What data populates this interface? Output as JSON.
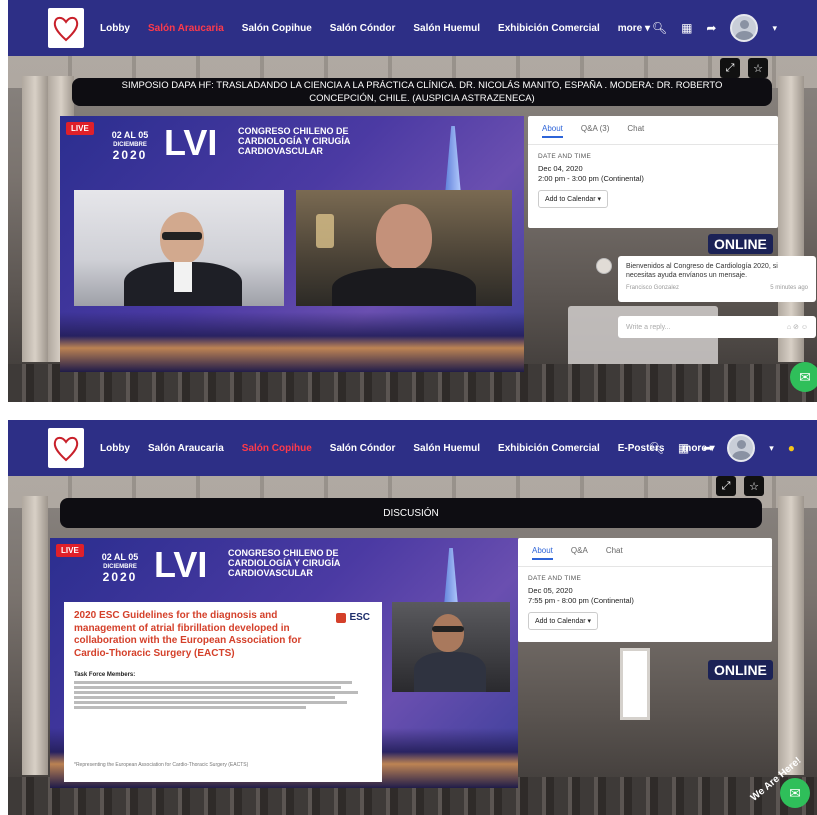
{
  "top": {
    "nav": {
      "items": [
        "Lobby",
        "Salón Araucaria",
        "Salón Copihue",
        "Salón Cóndor",
        "Salón Huemul",
        "Exhibición Comercial",
        "more"
      ],
      "active_index": 1
    },
    "session_title": "SIMPOSIO DAPA HF: TRASLADANDO LA CIENCIA A LA PRÁCTICA CLÍNICA. DR. NICOLÁS MANITO, ESPAÑA . MODERA: DR. ROBERTO CONCEPCIÓN, CHILE. (AUSPICIA ASTRAZENECA)",
    "stream": {
      "live": "LIVE",
      "dates_top": "02 AL 05",
      "dates_month": "DICIEMBRE",
      "dates_year": "2020",
      "lvi": "LVI",
      "congreso": "CONGRESO CHILENO DE CARDIOLOGÍA Y CIRUGÍA CARDIOVASCULAR"
    },
    "panel": {
      "tabs": [
        "About",
        "Q&A (3)",
        "Chat"
      ],
      "date_label": "DATE AND TIME",
      "date": "Dec 04, 2020",
      "time": "2:00 pm - 3:00 pm (Continental)",
      "calendar_btn": "Add to Calendar ▾"
    },
    "chat": {
      "message": "Bienvenidos al Congreso de Cardiología 2020, si necesitas ayuda envíanos un mensaje.",
      "author": "Francisco Gonzalez",
      "time": "5 minutes ago",
      "placeholder": "Write a reply..."
    },
    "online_sign": "ONLINE"
  },
  "bottom": {
    "nav": {
      "items": [
        "Lobby",
        "Salón Araucaria",
        "Salón Copihue",
        "Salón Cóndor",
        "Salón Huemul",
        "Exhibición Comercial",
        "E-Posters",
        "more"
      ],
      "active_index": 2
    },
    "session_title": "DISCUSIÓN",
    "stream": {
      "live": "LIVE",
      "dates_top": "02 AL 05",
      "dates_month": "DICIEMBRE",
      "dates_year": "2020",
      "lvi": "LVI",
      "congreso": "CONGRESO CHILENO DE CARDIOLOGÍA Y CIRUGÍA CARDIOVASCULAR"
    },
    "slide": {
      "title": "2020 ESC Guidelines for the diagnosis and management of atrial fibrillation developed in collaboration with the European Association for Cardio-Thoracic Surgery (EACTS)",
      "esc": "ESC",
      "task_force": "Task Force Members:",
      "footer": "*Representing the European Association for Cardio-Thoracic Surgery (EACTS)"
    },
    "panel": {
      "tabs": [
        "About",
        "Q&A",
        "Chat"
      ],
      "date_label": "DATE AND TIME",
      "date": "Dec 05, 2020",
      "time": "7:55 pm - 8:00 pm (Continental)",
      "calendar_btn": "Add to Calendar ▾"
    },
    "online_sign": "ONLINE",
    "we_are_here": "We Are Here!"
  },
  "colors": {
    "nav_bg": "#2d2f86",
    "active": "#ff3a4a",
    "fab": "#2fbf5a",
    "slide_title": "#d4402a"
  },
  "icons": [
    "search-icon",
    "schedule-icon",
    "share-icon",
    "avatar",
    "chevron-down-icon",
    "fullscreen-icon",
    "star-icon",
    "chat-icon",
    "heart-logo"
  ]
}
